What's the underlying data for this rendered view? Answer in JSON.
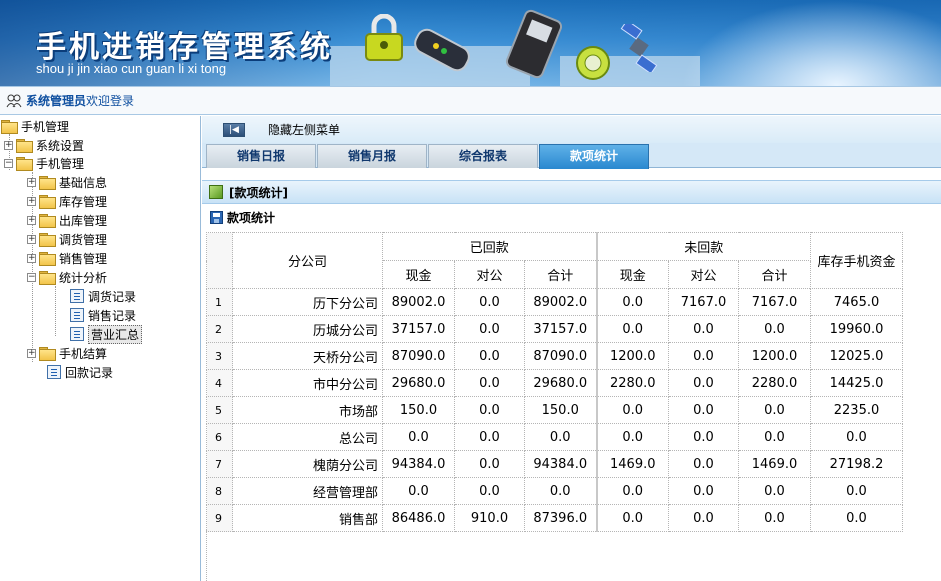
{
  "banner": {
    "title": "手机进销存管理系统",
    "subtitle": "shou ji jin xiao cun guan li xi tong",
    "colors": {
      "sky_top": "#1b6fb8",
      "sky_bottom": "#84c2ef",
      "title_text": "#ffffff"
    }
  },
  "userbar": {
    "username": "系统管理员",
    "welcome": "欢迎登录"
  },
  "tree": {
    "root": "手机管理",
    "system_settings": "系统设置",
    "phone_mgmt": "手机管理",
    "children": [
      "基础信息",
      "库存管理",
      "出库管理",
      "调货管理",
      "销售管理",
      "统计分析"
    ],
    "stats_children": [
      "调货记录",
      "销售记录",
      "营业汇总"
    ],
    "phone_settlement": "手机结算",
    "payment_record": "回款记录"
  },
  "main": {
    "hide_menu": "隐藏左侧菜单",
    "tabs": [
      "销售日报",
      "销售月报",
      "综合报表",
      "款项统计"
    ],
    "active_tab": "款项统计",
    "panel_title": "[款项统计]",
    "section_title": "款项统计"
  },
  "table": {
    "headers": {
      "branch": "分公司",
      "received": "已回款",
      "unreceived": "未回款",
      "stock_funds": "库存手机资金",
      "cash": "现金",
      "corporate": "对公",
      "total": "合计"
    },
    "rows": [
      {
        "no": "1",
        "branch": "历下分公司",
        "r_cash": "89002.0",
        "r_corp": "0.0",
        "r_total": "89002.0",
        "u_cash": "0.0",
        "u_corp": "7167.0",
        "u_total": "7167.0",
        "stock": "7465.0"
      },
      {
        "no": "2",
        "branch": "历城分公司",
        "r_cash": "37157.0",
        "r_corp": "0.0",
        "r_total": "37157.0",
        "u_cash": "0.0",
        "u_corp": "0.0",
        "u_total": "0.0",
        "stock": "19960.0"
      },
      {
        "no": "3",
        "branch": "天桥分公司",
        "r_cash": "87090.0",
        "r_corp": "0.0",
        "r_total": "87090.0",
        "u_cash": "1200.0",
        "u_corp": "0.0",
        "u_total": "1200.0",
        "stock": "12025.0"
      },
      {
        "no": "4",
        "branch": "市中分公司",
        "r_cash": "29680.0",
        "r_corp": "0.0",
        "r_total": "29680.0",
        "u_cash": "2280.0",
        "u_corp": "0.0",
        "u_total": "2280.0",
        "stock": "14425.0"
      },
      {
        "no": "5",
        "branch": "市场部",
        "r_cash": "150.0",
        "r_corp": "0.0",
        "r_total": "150.0",
        "u_cash": "0.0",
        "u_corp": "0.0",
        "u_total": "0.0",
        "stock": "2235.0"
      },
      {
        "no": "6",
        "branch": "总公司",
        "r_cash": "0.0",
        "r_corp": "0.0",
        "r_total": "0.0",
        "u_cash": "0.0",
        "u_corp": "0.0",
        "u_total": "0.0",
        "stock": "0.0"
      },
      {
        "no": "7",
        "branch": "槐荫分公司",
        "r_cash": "94384.0",
        "r_corp": "0.0",
        "r_total": "94384.0",
        "u_cash": "1469.0",
        "u_corp": "0.0",
        "u_total": "1469.0",
        "stock": "27198.2"
      },
      {
        "no": "8",
        "branch": "经营管理部",
        "r_cash": "0.0",
        "r_corp": "0.0",
        "r_total": "0.0",
        "u_cash": "0.0",
        "u_corp": "0.0",
        "u_total": "0.0",
        "stock": "0.0"
      },
      {
        "no": "9",
        "branch": "销售部",
        "r_cash": "86486.0",
        "r_corp": "910.0",
        "r_total": "87396.0",
        "u_cash": "0.0",
        "u_corp": "0.0",
        "u_total": "0.0",
        "stock": "0.0"
      }
    ]
  },
  "icons": [
    "padlock-icon",
    "router-icon",
    "smartphone-icon",
    "gps-device-icon",
    "satellite-icon",
    "user-group-icon",
    "folder-icon",
    "document-icon",
    "cube-icon",
    "save-disk-icon",
    "collapse-arrow-icon"
  ]
}
